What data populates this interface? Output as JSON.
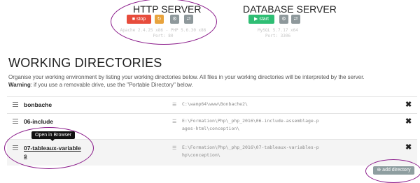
{
  "http_server": {
    "title": "HTTP SERVER",
    "stop_label": "stop",
    "info_line": "Apache 2.4.25 x86 - PHP 5.6.30 x86",
    "port_line": "Port: 80"
  },
  "database_server": {
    "title": "DATABASE SERVER",
    "start_label": "start",
    "info_line": "MySQL 5.7.17 x64",
    "port_line": "Port: 3306"
  },
  "working_directories": {
    "heading": "WORKING DIRECTORIES",
    "description": "Organise your working environment by listing your working directories below. All files in your working directories will be interpreted by the server.",
    "warning_label": "Warning",
    "warning_text": ": if you use a removable drive, use the \"Portable Directory\" below.",
    "rows": [
      {
        "name": "bonbache",
        "path_lines": [
          "C:\\wamp64\\www\\Bonbache2\\"
        ]
      },
      {
        "name": "06-include",
        "path_lines": [
          "E:\\Formation\\Php\\_php_2016\\06-include-assemblage-p",
          "ages-html\\conception\\"
        ]
      },
      {
        "name_lines": [
          "07-tableaux-variable",
          "s"
        ],
        "path_lines": [
          "E:\\Formation\\Php\\_php_2016\\07-tableaux-variables-p",
          "hp\\conception\\"
        ]
      }
    ],
    "tooltip": "Open in Browser",
    "add_directory_label": "add directory"
  },
  "icons": {
    "stop": "square-icon",
    "restart": "refresh-icon",
    "settings": "gear-icon",
    "switch": "swap-arrows-icon",
    "start": "play-icon",
    "drag": "hamburger-icon",
    "path": "list-icon",
    "remove": "close-icon",
    "add": "plus-circle-icon"
  },
  "colors": {
    "stop": "#e74c3c",
    "restart": "#e8a33d",
    "start": "#2fbe74",
    "neutral": "#8e989b",
    "annotation": "#8a1a8a"
  }
}
